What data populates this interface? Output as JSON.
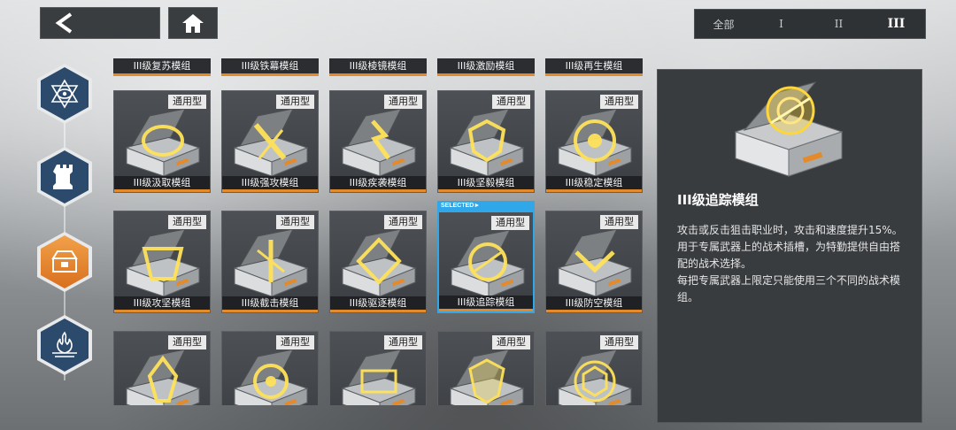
{
  "topbar": {
    "tiers": [
      "全部",
      "I",
      "II",
      "III"
    ],
    "active_tier": "III"
  },
  "nav": {
    "items": [
      {
        "name": "star-emblem-tab",
        "active": false
      },
      {
        "name": "chess-rook-tab",
        "active": false
      },
      {
        "name": "module-box-tab",
        "active": true
      },
      {
        "name": "flame-emblem-tab",
        "active": false
      }
    ]
  },
  "grid": {
    "top_row": [
      "III级复苏模组",
      "III级铁幕模组",
      "III级棱镜模组",
      "III级激励模组",
      "III级再生模组"
    ],
    "cards": [
      {
        "tag": "通用型",
        "name": "III级汲取模组"
      },
      {
        "tag": "通用型",
        "name": "III级强攻模组"
      },
      {
        "tag": "通用型",
        "name": "III级疾袭模组"
      },
      {
        "tag": "通用型",
        "name": "III级坚毅模组"
      },
      {
        "tag": "通用型",
        "name": "III级稳定模组"
      },
      {
        "tag": "通用型",
        "name": "III级攻坚模组"
      },
      {
        "tag": "通用型",
        "name": "III级截击模组"
      },
      {
        "tag": "通用型",
        "name": "III级驱逐模组"
      },
      {
        "tag": "通用型",
        "name": "III级追踪模组",
        "selected": true
      },
      {
        "tag": "通用型",
        "name": "III级防空模组"
      },
      {
        "tag": "通用型",
        "name": ""
      },
      {
        "tag": "通用型",
        "name": ""
      },
      {
        "tag": "通用型",
        "name": ""
      },
      {
        "tag": "通用型",
        "name": ""
      },
      {
        "tag": "通用型",
        "name": ""
      }
    ],
    "selected_label": "SELECTED►",
    "accent": "#e28a2c",
    "selected_color": "#2fa7e8"
  },
  "detail": {
    "title": "III级追踪模组",
    "desc": [
      "攻击或反击狙击职业时，攻击和速度提升15%。",
      "用于专属武器上的战术插槽，为特勤提供自由搭配的战术选择。",
      "每把专属武器上限定只能使用三个不同的战术模组。"
    ]
  }
}
